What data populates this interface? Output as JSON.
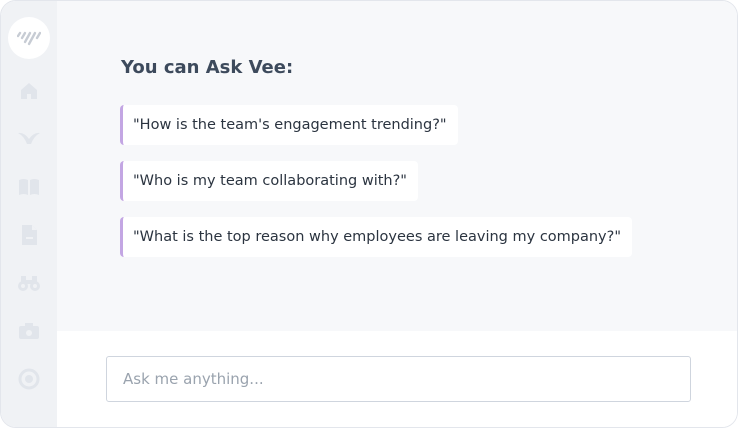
{
  "sidebar": {
    "logo_icon": "vee-logo-icon",
    "items": [
      {
        "icon": "home-icon"
      },
      {
        "icon": "bird-icon"
      },
      {
        "icon": "book-icon"
      },
      {
        "icon": "document-icon"
      },
      {
        "icon": "binoculars-icon"
      },
      {
        "icon": "camera-icon"
      },
      {
        "icon": "circle-icon"
      }
    ]
  },
  "main": {
    "heading": "You can Ask Vee:",
    "suggestions": [
      "\"How is the team's engagement trending?\"",
      "\"Who is my team collaborating with?\"",
      "\"What is the top reason why employees are leaving my company?\""
    ]
  },
  "input": {
    "placeholder": "Ask me anything...",
    "value": ""
  },
  "colors": {
    "sidebar_bg": "#f0f2f5",
    "main_bg": "#f7f8fa",
    "accent": "#c3a6e3",
    "heading": "#3d4a5c",
    "icon": "#e1e5eb"
  }
}
